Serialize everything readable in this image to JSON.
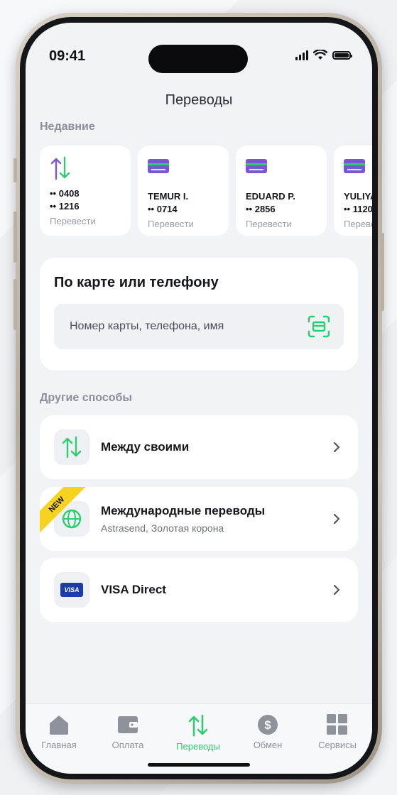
{
  "status": {
    "time": "09:41"
  },
  "header": {
    "title": "Переводы"
  },
  "recent": {
    "label": "Недавние",
    "items": [
      {
        "icon": "transfer-arrows-icon",
        "line1": "•• 0408",
        "line2": "•• 1216",
        "action": "Перевести"
      },
      {
        "icon": "bank-card-icon",
        "line1": "TEMUR I.",
        "line2": "•• 0714",
        "action": "Перевести"
      },
      {
        "icon": "bank-card-icon",
        "line1": "EDUARD P.",
        "line2": "•• 2856",
        "action": "Перевести"
      },
      {
        "icon": "bank-card-icon",
        "line1": "YULIYA",
        "line2": "•• 1120",
        "action": "Перевести"
      }
    ]
  },
  "search": {
    "title": "По карте или телефону",
    "placeholder": "Номер карты, телефона, имя",
    "value": ""
  },
  "other": {
    "label": "Другие способы",
    "methods": [
      {
        "icon": "transfer-arrows-icon",
        "title": "Между своими",
        "subtitle": ""
      },
      {
        "icon": "globe-icon",
        "title": "Международные переводы",
        "subtitle": "Astrasend, Золотая корона",
        "badge": "NEW"
      },
      {
        "icon": "visa-icon",
        "title": "VISA Direct",
        "subtitle": "",
        "badge_text": "VISA"
      }
    ]
  },
  "tabs": [
    {
      "label": "Главная",
      "icon": "home-icon"
    },
    {
      "label": "Оплата",
      "icon": "wallet-icon"
    },
    {
      "label": "Переводы",
      "icon": "transfer-arrows-icon",
      "active": true
    },
    {
      "label": "Обмен",
      "icon": "dollar-coin-icon"
    },
    {
      "label": "Сервисы",
      "icon": "services-grid-icon"
    }
  ],
  "colors": {
    "accent": "#2ecc71",
    "purple": "#7a57d1",
    "badge": "#f5d31e",
    "visa": "#1a3ea6"
  }
}
